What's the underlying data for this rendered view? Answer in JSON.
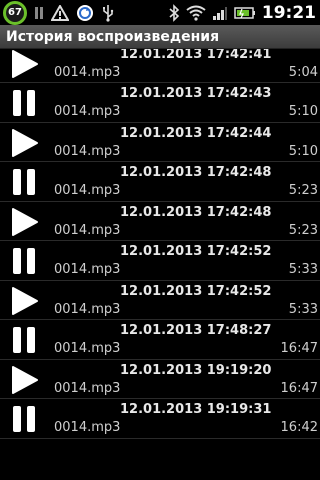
{
  "status_bar": {
    "battery_level": "67",
    "time": "19:21"
  },
  "title": "История воспроизведения",
  "history": [
    {
      "icon": "pause-icon",
      "timestamp": "12.01.2013 17:42:41",
      "file": "0014.mp3",
      "duration": "5:04"
    },
    {
      "icon": "play-icon",
      "timestamp": "12.01.2013 17:42:41",
      "file": "0014.mp3",
      "duration": "5:04"
    },
    {
      "icon": "pause-icon",
      "timestamp": "12.01.2013 17:42:43",
      "file": "0014.mp3",
      "duration": "5:10"
    },
    {
      "icon": "play-icon",
      "timestamp": "12.01.2013 17:42:44",
      "file": "0014.mp3",
      "duration": "5:10"
    },
    {
      "icon": "pause-icon",
      "timestamp": "12.01.2013 17:42:48",
      "file": "0014.mp3",
      "duration": "5:23"
    },
    {
      "icon": "play-icon",
      "timestamp": "12.01.2013 17:42:48",
      "file": "0014.mp3",
      "duration": "5:23"
    },
    {
      "icon": "pause-icon",
      "timestamp": "12.01.2013 17:42:52",
      "file": "0014.mp3",
      "duration": "5:33"
    },
    {
      "icon": "play-icon",
      "timestamp": "12.01.2013 17:42:52",
      "file": "0014.mp3",
      "duration": "5:33"
    },
    {
      "icon": "pause-icon",
      "timestamp": "12.01.2013 17:48:27",
      "file": "0014.mp3",
      "duration": "16:47"
    },
    {
      "icon": "play-icon",
      "timestamp": "12.01.2013 19:19:20",
      "file": "0014.mp3",
      "duration": "16:47"
    },
    {
      "icon": "pause-icon",
      "timestamp": "12.01.2013 19:19:31",
      "file": "0014.mp3",
      "duration": "16:42"
    }
  ]
}
